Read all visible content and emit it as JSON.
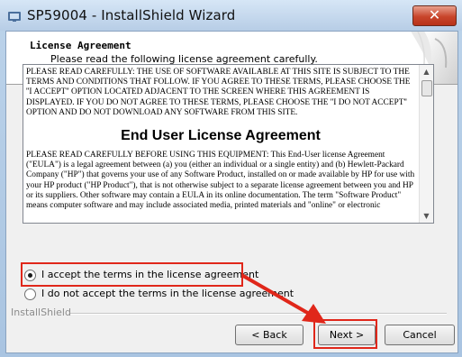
{
  "window": {
    "title": "SP59004 - InstallShield Wizard",
    "close_glyph": "✕",
    "icon": "installshield-app-icon"
  },
  "header": {
    "title": "License Agreement",
    "subtitle": "Please read the following license agreement carefully."
  },
  "license": {
    "intro": "PLEASE READ CAREFULLY: THE USE OF SOFTWARE AVAILABLE AT THIS SITE IS SUBJECT TO THE TERMS AND CONDITIONS THAT FOLLOW. IF YOU AGREE TO THESE TERMS, PLEASE CHOOSE THE ''I ACCEPT'' OPTION LOCATED ADJACENT TO THE SCREEN WHERE THIS AGREEMENT IS DISPLAYED. IF YOU DO NOT AGREE TO THESE TERMS, PLEASE CHOOSE THE ''I DO NOT ACCEPT'' OPTION AND DO NOT DOWNLOAD ANY SOFTWARE FROM THIS SITE.",
    "heading": "End User License Agreement",
    "body": "PLEASE READ CAREFULLY BEFORE USING THIS EQUIPMENT: This End-User license Agreement (\"EULA\") is a legal agreement between (a) you (either an individual or a single entity) and (b) Hewlett-Packard Company (\"HP\") that governs your use of any Software Product, installed on or made available by HP for use with your HP product (\"HP Product\"), that is not otherwise subject to a separate license agreement between you and HP or its suppliers. Other software may contain a EULA in its online documentation. The term \"Software Product\" means computer software and may include associated media, printed materials and \"online\" or electronic"
  },
  "options": {
    "accept": "I accept the terms in the license agreement",
    "decline": "I do not accept the terms in the license agreement",
    "selected": "accept"
  },
  "footer": {
    "brand": "InstallShield"
  },
  "buttons": {
    "back": "< Back",
    "next": "Next >",
    "cancel": "Cancel"
  },
  "colors": {
    "highlight": "#e0271a",
    "title_bar": "#b7cde6",
    "close_button": "#c8452b"
  },
  "annotations": {
    "highlight_boxes": [
      "accept-option",
      "next-button"
    ],
    "arrow": "accept-option-to-next-button"
  }
}
